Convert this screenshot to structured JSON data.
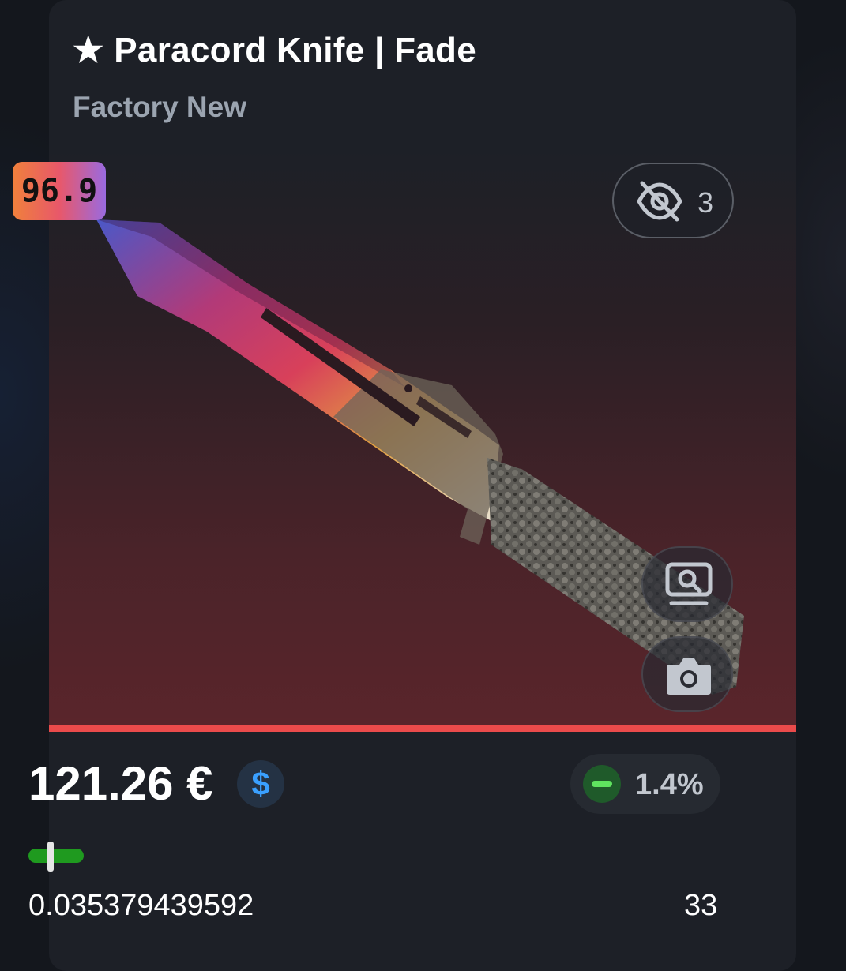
{
  "item": {
    "name": "★ Paracord Knife | Fade",
    "wear": "Factory New",
    "fade_percentage": "96.9",
    "watchers": "3",
    "price": "121.26 €",
    "currency_icon": "$",
    "price_change": "1.4%",
    "float_value": "0.035379439592",
    "paint_seed": "33",
    "float_position": 0.035
  },
  "colors": {
    "rarity": "#eb4b4b",
    "change_positive": "#5fe35f",
    "float_bar": "#1f9a1f",
    "currency_accent": "#3aa0ff"
  },
  "icons": {
    "watchers": "eye-slash-icon",
    "inspect": "inspect-icon",
    "screenshot": "camera-icon",
    "currency": "dollar-icon",
    "change": "minus-icon"
  }
}
